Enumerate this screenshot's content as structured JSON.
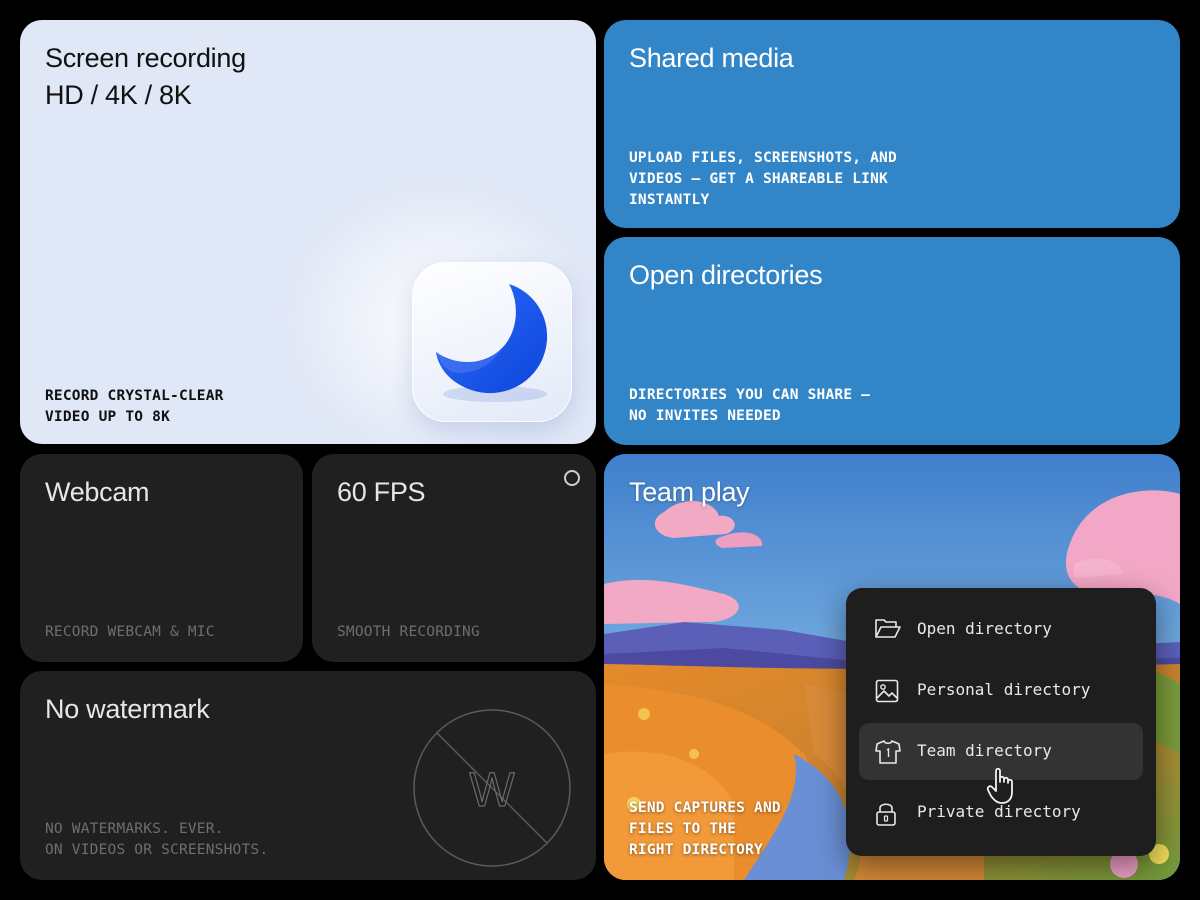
{
  "cards": {
    "screen_recording": {
      "title": "Screen recording\nHD / 4K / 8K",
      "description": "RECORD CRYSTAL-CLEAR\nVIDEO UP TO 8K",
      "icon": "moon-icon"
    },
    "shared_media": {
      "title": "Shared media",
      "description": "UPLOAD FILES, SCREENSHOTS, AND\nVIDEOS — GET A SHAREABLE LINK\nINSTANTLY"
    },
    "open_directories": {
      "title": "Open directories",
      "description": "DIRECTORIES YOU CAN SHARE —\nNO INVITES NEEDED"
    },
    "webcam": {
      "title": "Webcam",
      "description": "RECORD WEBCAM & MIC"
    },
    "fps": {
      "title": "60 FPS",
      "description": "SMOOTH RECORDING"
    },
    "watermark": {
      "title": "No watermark",
      "description": "NO WATERMARKS. EVER.\nON VIDEOS OR SCREENSHOTS.",
      "icon_letter": "W"
    },
    "team_play": {
      "title": "Team play",
      "description": "SEND CAPTURES AND\nFILES TO THE\nRIGHT DIRECTORY"
    }
  },
  "directory_menu": {
    "items": [
      {
        "label": "Open directory",
        "icon": "folder-open-icon"
      },
      {
        "label": "Personal directory",
        "icon": "image-icon"
      },
      {
        "label": "Team directory",
        "icon": "shirt-icon",
        "active": true
      },
      {
        "label": "Private directory",
        "icon": "lock-icon"
      }
    ]
  },
  "colors": {
    "blue_card": "#3285c6",
    "dark_card": "#202020",
    "recording_card": "#e0e7f6",
    "moon": "#1a5cf0"
  }
}
